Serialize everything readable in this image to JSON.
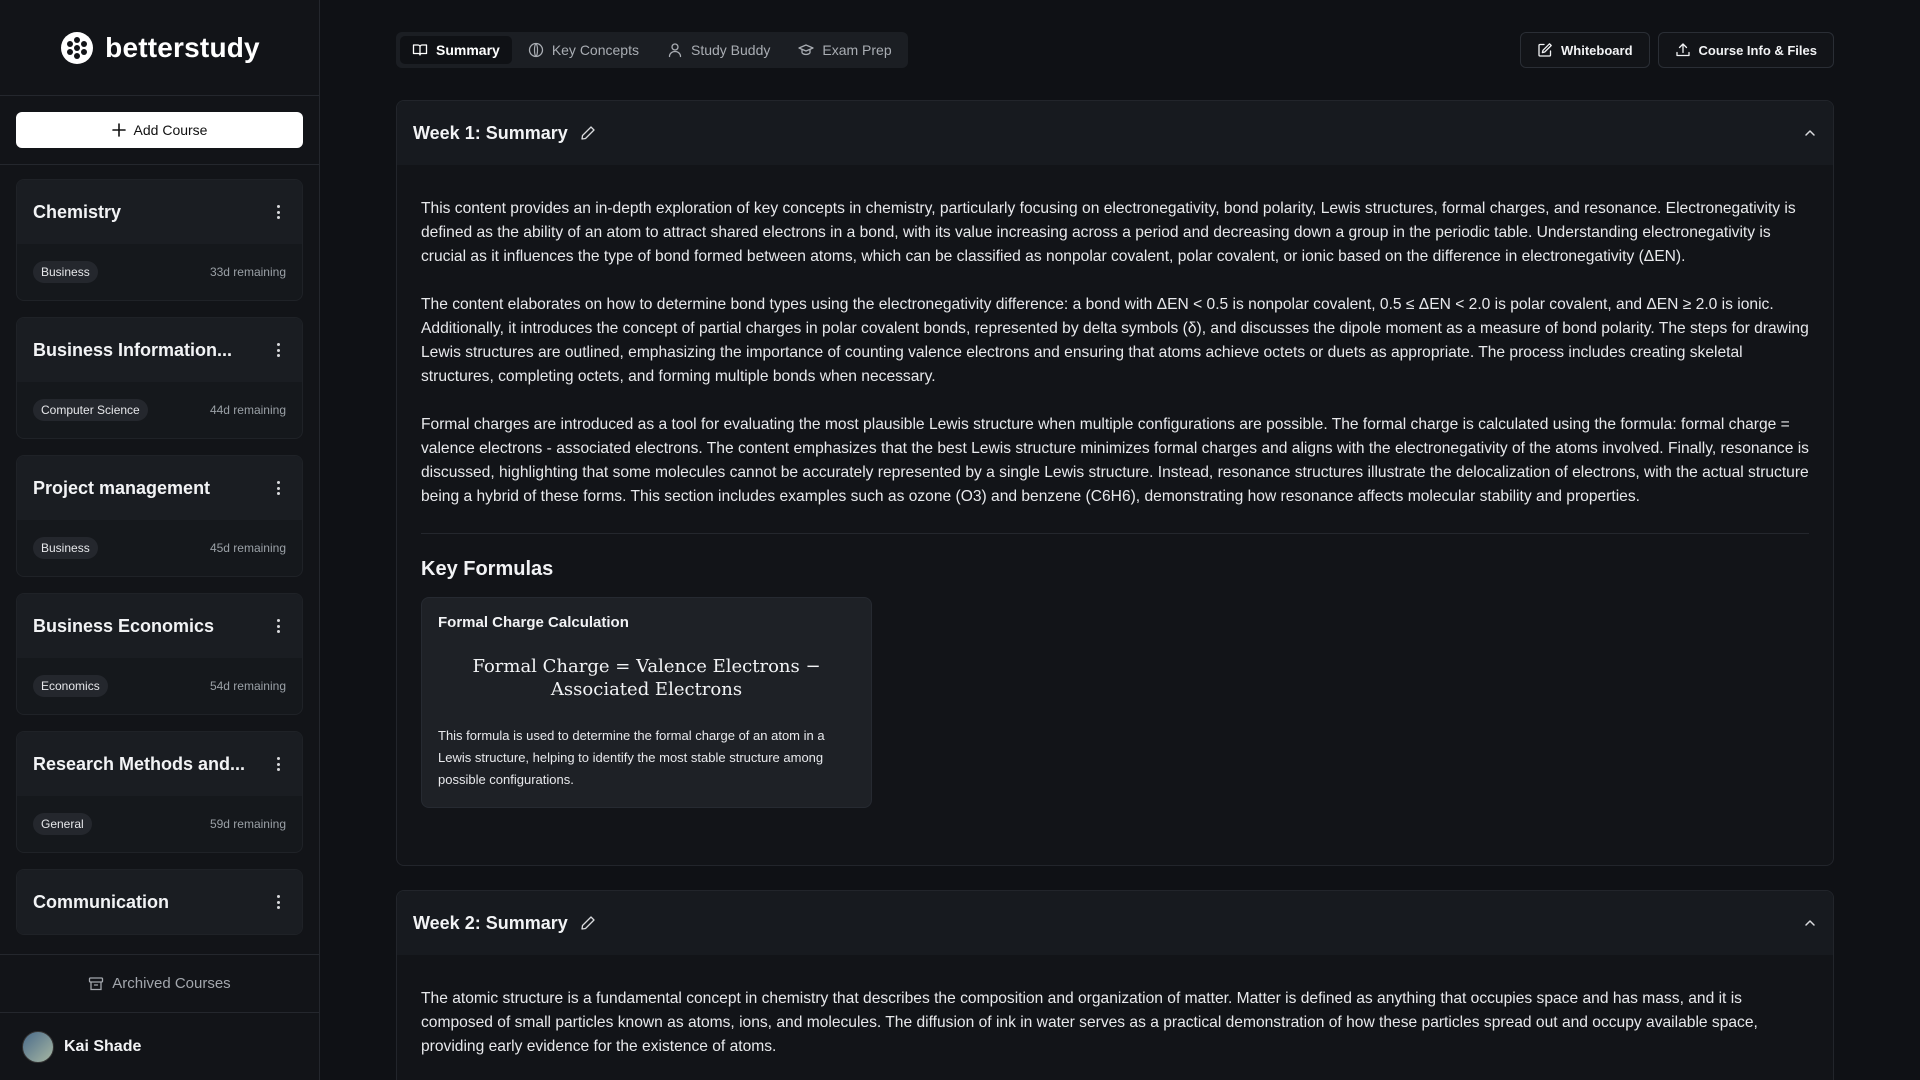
{
  "brand": {
    "name": "betterstudy"
  },
  "sidebar": {
    "add_course": "Add Course",
    "courses": [
      {
        "title": "Chemistry",
        "tag": "Business",
        "remaining": "33d remaining"
      },
      {
        "title": "Business Information...",
        "tag": "Computer Science",
        "remaining": "44d remaining"
      },
      {
        "title": "Project management",
        "tag": "Business",
        "remaining": "45d remaining"
      },
      {
        "title": "Business Economics",
        "tag": "Economics",
        "remaining": "54d remaining"
      },
      {
        "title": "Research Methods and...",
        "tag": "General",
        "remaining": "59d remaining"
      },
      {
        "title": "Communication",
        "tag": "",
        "remaining": ""
      }
    ],
    "archived": "Archived Courses",
    "user": {
      "name": "Kai Shade"
    }
  },
  "tabs": [
    {
      "label": "Summary",
      "icon": "book-open-icon"
    },
    {
      "label": "Key Concepts",
      "icon": "globe-icon"
    },
    {
      "label": "Study Buddy",
      "icon": "user-icon"
    },
    {
      "label": "Exam Prep",
      "icon": "graduation-cap-icon"
    }
  ],
  "actions": {
    "whiteboard": "Whiteboard",
    "course_info": "Course Info & Files"
  },
  "weeks": [
    {
      "title": "Week 1: Summary",
      "paragraphs": [
        "This content provides an in-depth exploration of key concepts in chemistry, particularly focusing on electronegativity, bond polarity, Lewis structures, formal charges, and resonance. Electronegativity is defined as the ability of an atom to attract shared electrons in a bond, with its value increasing across a period and decreasing down a group in the periodic table. Understanding electronegativity is crucial as it influences the type of bond formed between atoms, which can be classified as nonpolar covalent, polar covalent, or ionic based on the difference in electronegativity (ΔEN).",
        "The content elaborates on how to determine bond types using the electronegativity difference: a bond with ΔEN < 0.5 is nonpolar covalent, 0.5 ≤ ΔEN < 2.0 is polar covalent, and ΔEN ≥ 2.0 is ionic. Additionally, it introduces the concept of partial charges in polar covalent bonds, represented by delta symbols (δ), and discusses the dipole moment as a measure of bond polarity. The steps for drawing Lewis structures are outlined, emphasizing the importance of counting valence electrons and ensuring that atoms achieve octets or duets as appropriate. The process includes creating skeletal structures, completing octets, and forming multiple bonds when necessary.",
        "Formal charges are introduced as a tool for evaluating the most plausible Lewis structure when multiple configurations are possible. The formal charge is calculated using the formula: formal charge = valence electrons - associated electrons. The content emphasizes that the best Lewis structure minimizes formal charges and aligns with the electronegativity of the atoms involved. Finally, resonance is discussed, highlighting that some molecules cannot be accurately represented by a single Lewis structure. Instead, resonance structures illustrate the delocalization of electrons, with the actual structure being a hybrid of these forms. This section includes examples such as ozone (O3) and benzene (C6H6), demonstrating how resonance affects molecular stability and properties."
      ],
      "key_formulas_title": "Key Formulas",
      "formula": {
        "name": "Formal Charge Calculation",
        "math_line1": "Formal Charge = Valence Electrons −",
        "math_line2": "Associated Electrons",
        "description": "This formula is used to determine the formal charge of an atom in a Lewis structure, helping to identify the most stable structure among possible configurations."
      }
    },
    {
      "title": "Week 2: Summary",
      "paragraphs": [
        "The atomic structure is a fundamental concept in chemistry that describes the composition and organization of matter. Matter is defined as anything that occupies space and has mass, and it is composed of small particles known as atoms, ions, and molecules. The diffusion of ink in water serves as a practical demonstration of how these particles spread out and occupy available space, providing early evidence for the existence of atoms."
      ]
    }
  ],
  "colors": {
    "background": "#0f1115",
    "sidebar": "#121418",
    "accent": "#ffffff"
  }
}
